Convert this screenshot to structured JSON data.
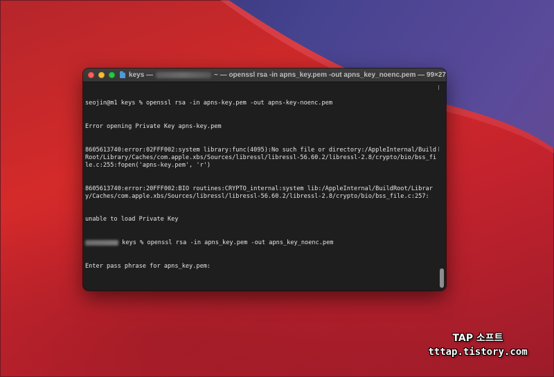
{
  "window": {
    "title_prefix": "keys —",
    "title_suffix": "~ — openssl rsa -in apns_key.pem -out apns_key_noenc.pem — 99×27"
  },
  "terminal": {
    "lines": [
      "seojin@m1 keys % openssl rsa -in apns-key.pem -out apns-key-noenc.pem",
      "Error opening Private Key apns-key.pem",
      "8605613740:error:02FFF002:system library:func(4095):No such file or directory:/AppleInternal/BuildRoot/Library/Caches/com.apple.xbs/Sources/libressl/libressl-56.60.2/libressl-2.8/crypto/bio/bss_file.c:255:fopen('apns-key.pem', 'r')",
      "8605613740:error:20FFF002:BIO routines:CRYPTO_internal:system lib:/AppleInternal/BuildRoot/Library/Caches/com.apple.xbs/Sources/libressl/libressl-56.60.2/libressl-2.8/crypto/bio/bss_file.c:257:",
      "unable to load Private Key"
    ],
    "second_prompt_tail": " keys % openssl rsa -in apns_key.pem -out apns_key_noenc.pem",
    "last_line": "Enter pass phrase for apns_key.pem:"
  },
  "watermark": {
    "line1": "TAP 소프트",
    "line2": "tttap.tistory.com"
  },
  "colors": {
    "terminal_bg": "#1e1e1e",
    "terminal_text": "#e6e6e6",
    "close": "#ff5f57",
    "minimize": "#febc2e",
    "maximize": "#28c840"
  }
}
